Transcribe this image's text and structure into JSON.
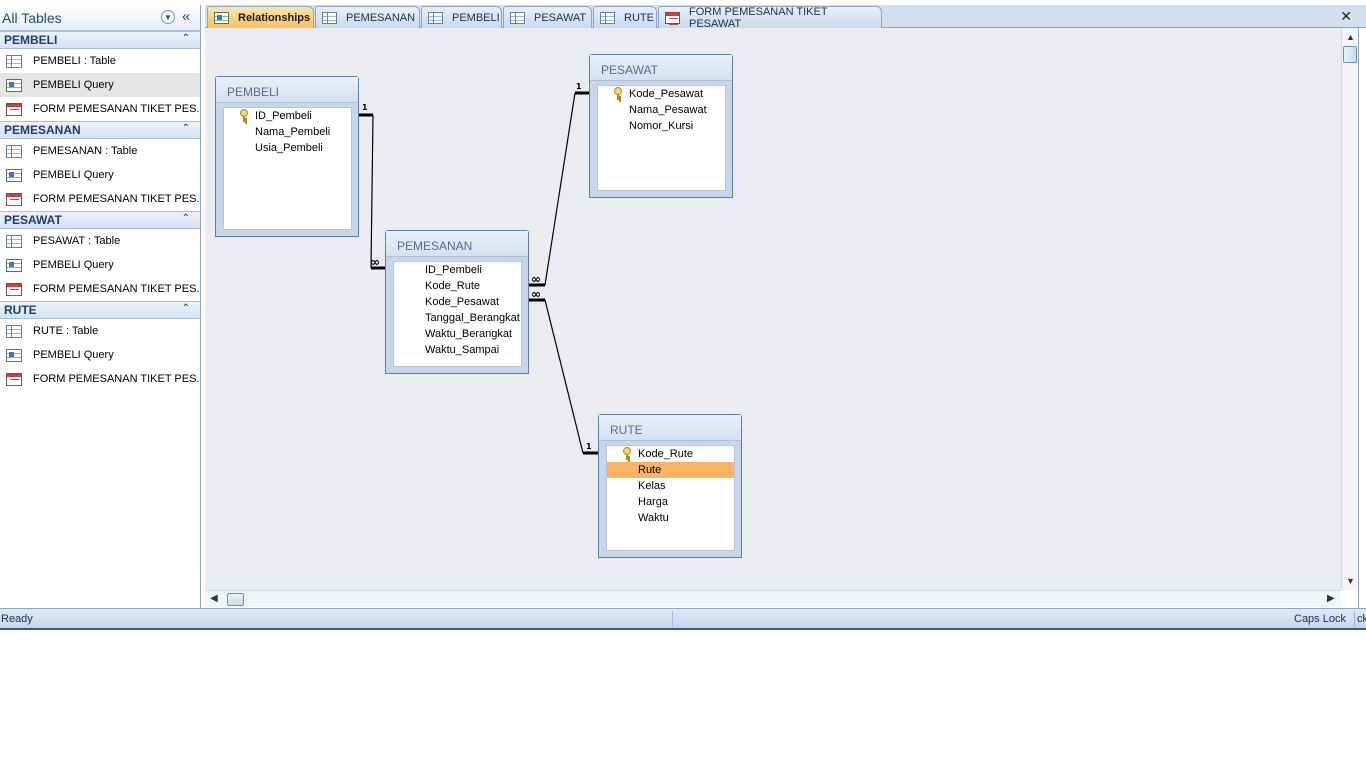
{
  "nav": {
    "title": "All Tables",
    "groups": [
      {
        "name": "PEMBELI",
        "items": [
          {
            "label": "PEMBELI : Table",
            "icon": "table-icon"
          },
          {
            "label": "PEMBELI Query",
            "icon": "query-icon",
            "selected": true
          },
          {
            "label": "FORM PEMESANAN TIKET PES...",
            "icon": "form-icon"
          }
        ]
      },
      {
        "name": "PEMESANAN",
        "items": [
          {
            "label": "PEMESANAN : Table",
            "icon": "table-icon"
          },
          {
            "label": "PEMBELI Query",
            "icon": "query-icon"
          },
          {
            "label": "FORM PEMESANAN TIKET PES...",
            "icon": "form-icon"
          }
        ]
      },
      {
        "name": "PESAWAT",
        "items": [
          {
            "label": "PESAWAT : Table",
            "icon": "table-icon"
          },
          {
            "label": "PEMBELI Query",
            "icon": "query-icon"
          },
          {
            "label": "FORM PEMESANAN TIKET PES...",
            "icon": "form-icon"
          }
        ]
      },
      {
        "name": "RUTE",
        "items": [
          {
            "label": "RUTE : Table",
            "icon": "table-icon"
          },
          {
            "label": "PEMBELI Query",
            "icon": "query-icon"
          },
          {
            "label": "FORM PEMESANAN TIKET PES...",
            "icon": "form-icon"
          }
        ]
      }
    ]
  },
  "tabs": [
    {
      "label": "Relationships",
      "icon": "relationships-icon",
      "active": true
    },
    {
      "label": "PEMESANAN",
      "icon": "table-icon"
    },
    {
      "label": "PEMBELI",
      "icon": "table-icon"
    },
    {
      "label": "PESAWAT",
      "icon": "table-icon"
    },
    {
      "label": "RUTE",
      "icon": "table-icon"
    },
    {
      "label": "FORM PEMESANAN TIKET PESAWAT",
      "icon": "form-icon"
    }
  ],
  "tables": {
    "pembeli": {
      "title": "PEMBELI",
      "fields": [
        {
          "name": "ID_Pembeli",
          "key": true
        },
        {
          "name": "Nama_Pembeli"
        },
        {
          "name": "Usia_Pembeli"
        }
      ]
    },
    "pemesanan": {
      "title": "PEMESANAN",
      "fields": [
        {
          "name": "ID_Pembeli"
        },
        {
          "name": "Kode_Rute"
        },
        {
          "name": "Kode_Pesawat"
        },
        {
          "name": "Tanggal_Berangkat"
        },
        {
          "name": "Waktu_Berangkat"
        },
        {
          "name": "Waktu_Sampai"
        }
      ]
    },
    "pesawat": {
      "title": "PESAWAT",
      "fields": [
        {
          "name": "Kode_Pesawat",
          "key": true
        },
        {
          "name": "Nama_Pesawat"
        },
        {
          "name": "Nomor_Kursi"
        }
      ]
    },
    "rute": {
      "title": "RUTE",
      "fields": [
        {
          "name": "Kode_Rute",
          "key": true
        },
        {
          "name": "Rute",
          "highlighted": true
        },
        {
          "name": "Kelas"
        },
        {
          "name": "Harga"
        },
        {
          "name": "Waktu"
        }
      ]
    }
  },
  "relationships": [
    {
      "from": "PEMBELI",
      "to": "PEMESANAN",
      "one_label": "1",
      "many_label": "∞"
    },
    {
      "from": "PESAWAT",
      "to": "PEMESANAN",
      "one_label": "1",
      "many_label": "∞"
    },
    {
      "from": "RUTE",
      "to": "PEMESANAN",
      "one_label": "1",
      "many_label": "∞"
    }
  ],
  "status": {
    "left": "Ready",
    "caps": "Caps Lock",
    "trail": "ck"
  },
  "colors": {
    "active_tab": "#f9c25c",
    "highlight_row": "#fbb361",
    "canvas": "#eaecef"
  }
}
